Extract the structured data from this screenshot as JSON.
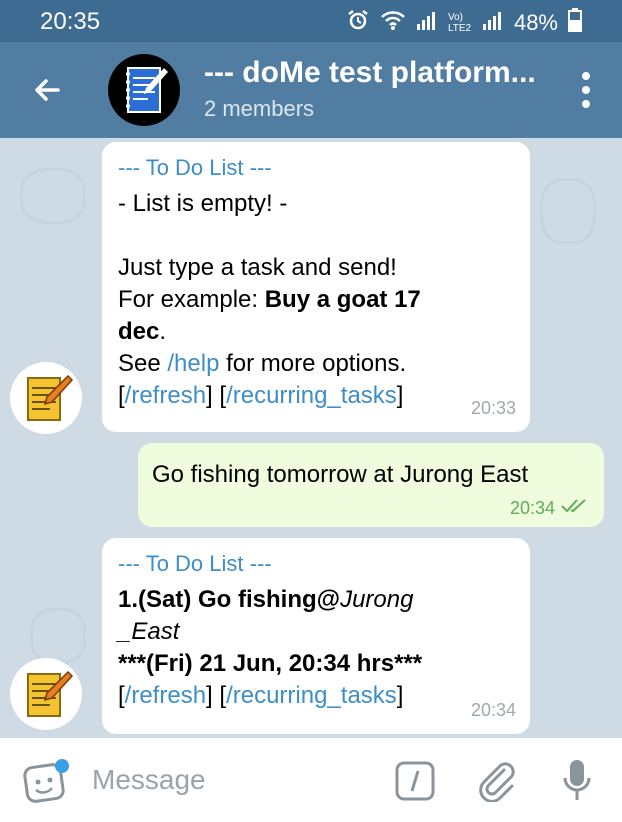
{
  "status": {
    "time": "20:35",
    "volte": "Vo) LTE2",
    "battery": "48%"
  },
  "header": {
    "title": "--- doMe test platform...",
    "subtitle": "2 members"
  },
  "messages": [
    {
      "heading": "--- To Do List ---",
      "line1": "- List is empty! -",
      "line2": "Just type a task and send!",
      "line3_prefix": "For example: ",
      "line3_bold": "Buy a goat 17",
      "line4_bold": "dec",
      "line4_suffix": ".",
      "line5_prefix": "See ",
      "line5_link": "/help",
      "line5_suffix": " for more options.",
      "link_refresh": "/refresh",
      "link_recurring": "/recurring_tasks",
      "time": "20:33"
    },
    {
      "text": "Go fishing tomorrow at Jurong East",
      "time": "20:34"
    },
    {
      "heading": "--- To Do List ---",
      "task_prefix": "1.(Sat) Go fishing@",
      "task_italic1": "Jurong",
      "task_italic2": "_East",
      "due": "***(Fri) 21 Jun, 20:34 hrs***",
      "link_refresh": "/refresh",
      "link_recurring": "/recurring_tasks",
      "time": "20:34"
    }
  ],
  "input": {
    "placeholder": "Message"
  },
  "colors": {
    "header": "#517da2",
    "statusbar": "#3e6b92",
    "link": "#3d8ec9",
    "outgoing": "#effdde",
    "tick": "#5fae55"
  }
}
